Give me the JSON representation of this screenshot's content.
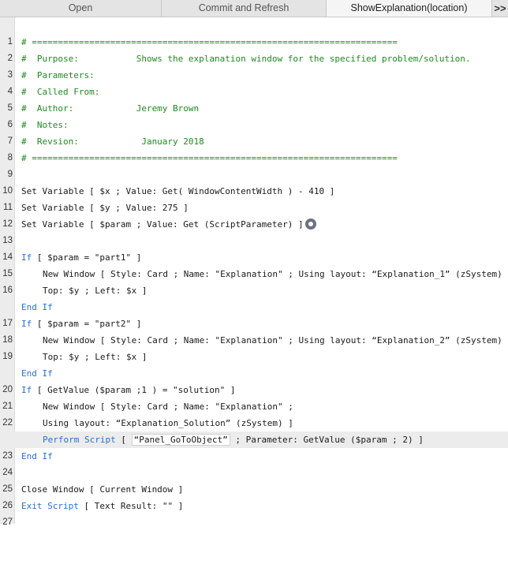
{
  "tabs": [
    {
      "label": "Open",
      "active": false
    },
    {
      "label": "Commit and Refresh",
      "active": false
    },
    {
      "label": "ShowExplanation(location)",
      "active": true
    }
  ],
  "tab_overflow_label": ">>",
  "lines": [
    {
      "num": "1",
      "text": ""
    },
    {
      "num": "2",
      "text": "# ======================================================================"
    },
    {
      "num": "3",
      "text": "#  Purpose:           Shows the explanation window for the specified problem/solution."
    },
    {
      "num": "4",
      "text": "#  Parameters:"
    },
    {
      "num": "5",
      "text": "#  Called From:"
    },
    {
      "num": "6",
      "text": "#  Author:            Jeremy Brown"
    },
    {
      "num": "7",
      "text": "#  Notes:"
    },
    {
      "num": "8",
      "text": "#  Revsion:            January 2018"
    },
    {
      "num": "9",
      "text": "# ======================================================================"
    },
    {
      "num": "10",
      "text": ""
    },
    {
      "num": "11",
      "text": "Set Variable [ $x ; Value: Get( WindowContentWidth ) - 410 ]"
    },
    {
      "num": "12",
      "text": "Set Variable [ $y ; Value: 275 ]"
    },
    {
      "num": "13",
      "text": "Set Variable [ $param ; Value: Get (ScriptParameter) ]"
    },
    {
      "num": "14",
      "text": ""
    },
    {
      "num": "15",
      "kw": "If",
      "text": " [ $param = \"part1\" ]"
    },
    {
      "num": "16",
      "text": "New Window [ Style: Card ; Name: \"Explanation\" ; Using layout: “Explanation_1” (zSystem) ;"
    },
    {
      "num": "",
      "text": "Top: $y ; Left: $x ]"
    },
    {
      "num": "17",
      "kw": "End If",
      "text": ""
    },
    {
      "num": "18",
      "kw": "If",
      "text": " [ $param = \"part2\" ]"
    },
    {
      "num": "19",
      "text": "New Window [ Style: Card ; Name: \"Explanation\" ; Using layout: “Explanation_2” (zSystem) ;"
    },
    {
      "num": "",
      "text": "Top: $y ; Left: $x ]"
    },
    {
      "num": "20",
      "kw": "End If",
      "text": ""
    },
    {
      "num": "21",
      "kw": "If",
      "text": " [ GetValue ($param ;1 ) = \"solution\" ]"
    },
    {
      "num": "22",
      "text": "New Window [ Style: Card ; Name: \"Explanation\" ;"
    },
    {
      "num": "",
      "text": "Using layout: “Explanation_Solution” (zSystem) ]"
    },
    {
      "num": "23",
      "kw": "Perform Script",
      "text_pre": " [ ",
      "boxed": "“Panel_GoToObject”",
      "text": " ; Parameter: GetValue ($param ; 2) ]"
    },
    {
      "num": "24",
      "kw": "End If",
      "text": ""
    },
    {
      "num": "25",
      "text": ""
    },
    {
      "num": "26",
      "text": "Close Window [ Current Window ]"
    },
    {
      "num": "27",
      "kw": "Exit Script",
      "text": " [ Text Result: \"\" ]"
    }
  ]
}
